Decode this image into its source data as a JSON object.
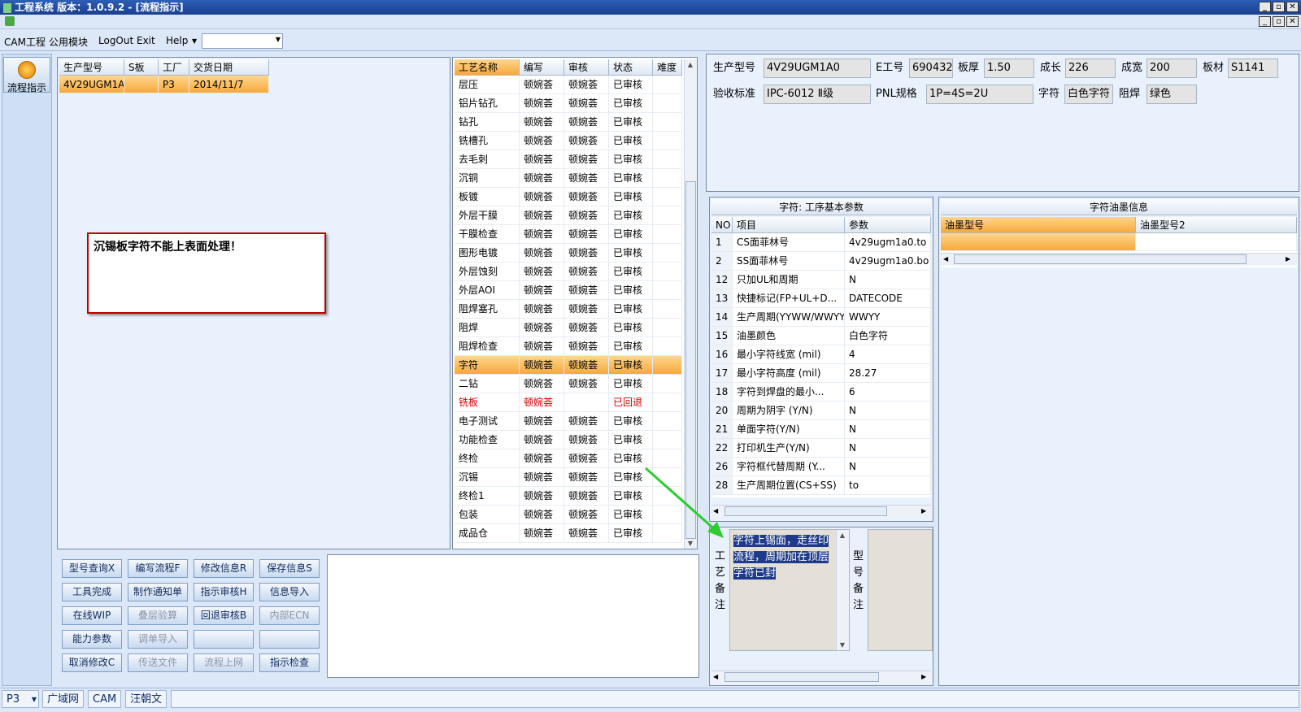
{
  "titlebar": {
    "text": "工程系统   版本：1.0.9.2 - [流程指示]",
    "min": "_",
    "max": "▫",
    "close": "✕"
  },
  "mdi": {
    "min": "_",
    "max": "▫",
    "close": "✕"
  },
  "menu": {
    "items": [
      "CAM工程",
      "公用模块",
      "LogOut",
      "Exit",
      "Help"
    ],
    "combo_value": ""
  },
  "left_nav": {
    "flow_button": "流程指示"
  },
  "order_table": {
    "headers": [
      "生产型号",
      "S板",
      "工厂",
      "交货日期"
    ],
    "rows": [
      [
        "4V29UGM1A0",
        "",
        "P3",
        "2014/11/7"
      ]
    ]
  },
  "note": {
    "text": "沉锡板字符不能上表面处理！"
  },
  "process_table": {
    "headers": [
      "工艺名称",
      "编写",
      "审核",
      "状态",
      "难度"
    ],
    "rows": [
      [
        "层压",
        "顿婉荟",
        "顿婉荟",
        "已审核",
        ""
      ],
      [
        "铝片钻孔",
        "顿婉荟",
        "顿婉荟",
        "已审核",
        ""
      ],
      [
        "钻孔",
        "顿婉荟",
        "顿婉荟",
        "已审核",
        ""
      ],
      [
        "铣槽孔",
        "顿婉荟",
        "顿婉荟",
        "已审核",
        ""
      ],
      [
        "去毛刺",
        "顿婉荟",
        "顿婉荟",
        "已审核",
        ""
      ],
      [
        "沉铜",
        "顿婉荟",
        "顿婉荟",
        "已审核",
        ""
      ],
      [
        "板镀",
        "顿婉荟",
        "顿婉荟",
        "已审核",
        ""
      ],
      [
        "外层干膜",
        "顿婉荟",
        "顿婉荟",
        "已审核",
        ""
      ],
      [
        "干膜检查",
        "顿婉荟",
        "顿婉荟",
        "已审核",
        ""
      ],
      [
        "图形电镀",
        "顿婉荟",
        "顿婉荟",
        "已审核",
        ""
      ],
      [
        "外层蚀刻",
        "顿婉荟",
        "顿婉荟",
        "已审核",
        ""
      ],
      [
        "外层AOI",
        "顿婉荟",
        "顿婉荟",
        "已审核",
        ""
      ],
      [
        "阻焊塞孔",
        "顿婉荟",
        "顿婉荟",
        "已审核",
        ""
      ],
      [
        "阻焊",
        "顿婉荟",
        "顿婉荟",
        "已审核",
        ""
      ],
      [
        "阻焊检查",
        "顿婉荟",
        "顿婉荟",
        "已审核",
        ""
      ],
      [
        "字符",
        "顿婉荟",
        "顿婉荟",
        "已审核",
        ""
      ],
      [
        "二钻",
        "顿婉荟",
        "顿婉荟",
        "已审核",
        ""
      ],
      [
        "铣板",
        "顿婉荟",
        "",
        "已回退",
        ""
      ],
      [
        "电子测试",
        "顿婉荟",
        "顿婉荟",
        "已审核",
        ""
      ],
      [
        "功能检查",
        "顿婉荟",
        "顿婉荟",
        "已审核",
        ""
      ],
      [
        "终检",
        "顿婉荟",
        "顿婉荟",
        "已审核",
        ""
      ],
      [
        "沉锡",
        "顿婉荟",
        "顿婉荟",
        "已审核",
        ""
      ],
      [
        "终检1",
        "顿婉荟",
        "顿婉荟",
        "已审核",
        ""
      ],
      [
        "包装",
        "顿婉荟",
        "顿婉荟",
        "已审核",
        ""
      ],
      [
        "成品仓",
        "顿婉荟",
        "顿婉荟",
        "已审核",
        ""
      ]
    ]
  },
  "buttons": [
    [
      "型号查询X",
      "编写流程F",
      "修改信息R",
      "保存信息S"
    ],
    [
      "工具完成",
      "制作通知单",
      "指示审核H",
      "信息导入"
    ],
    [
      "在线WIP",
      "叠层验算",
      "回退审核B",
      "内部ECN"
    ],
    [
      "能力参数",
      "调单导入",
      "",
      ""
    ],
    [
      "取消修改C",
      "传送文件",
      "流程上网",
      "指示检查"
    ]
  ],
  "info": {
    "model_label": "生产型号",
    "model": "4V29UGM1A0",
    "eno_label": "E工号",
    "eno": "690432",
    "thick_label": "板厚",
    "thick": "1.50",
    "len_label": "成长",
    "len": "226",
    "wid_label": "成宽",
    "wid": "200",
    "mat_label": "板材",
    "mat": "S1141",
    "std_label": "验收标准",
    "std": "IPC-6012 Ⅱ级",
    "pnl_label": "PNL规格",
    "pnl": "1P=4S=2U",
    "char_label": "字符",
    "char": "白色字符",
    "mask_label": "阻焊",
    "mask": "绿色"
  },
  "params": {
    "title": "字符: 工序基本参数",
    "headers": [
      "NO",
      "项目",
      "参数"
    ],
    "rows": [
      [
        "1",
        "CS面菲林号",
        "4v29ugm1a0.to"
      ],
      [
        "2",
        "SS面菲林号",
        "4v29ugm1a0.bo"
      ],
      [
        "12",
        "只加UL和周期",
        "N"
      ],
      [
        "13",
        "快捷标记(FP+UL+D...",
        "DATECODE"
      ],
      [
        "14",
        "生产周期(YYWW/WWYY)",
        "WWYY"
      ],
      [
        "15",
        "油墨颜色",
        "白色字符"
      ],
      [
        "16",
        "最小字符线宽 (mil)",
        "4"
      ],
      [
        "17",
        "最小字符高度 (mil)",
        "28.27"
      ],
      [
        "18",
        "字符到焊盘的最小...",
        "6"
      ],
      [
        "20",
        "周期为阴字 (Y/N)",
        "N"
      ],
      [
        "21",
        "单面字符(Y/N)",
        "N"
      ],
      [
        "22",
        "打印机生产(Y/N)",
        "N"
      ],
      [
        "26",
        "字符框代替周期 (Y...",
        "N"
      ],
      [
        "28",
        "生产周期位置(CS+SS)",
        "to"
      ]
    ]
  },
  "ink": {
    "title": "字符油墨信息",
    "headers": [
      "油墨型号",
      "油墨型号2"
    ]
  },
  "remarks": {
    "process_label_chars": [
      "工",
      "艺",
      "备",
      "注"
    ],
    "process_text": "字符上锡面，走丝印流程，周期加在顶层字符已封",
    "model_label_chars": [
      "型",
      "号",
      "备",
      "注"
    ]
  },
  "status": {
    "factory": "P3",
    "tabs": [
      "广域网",
      "CAM",
      "汪朝文"
    ]
  }
}
